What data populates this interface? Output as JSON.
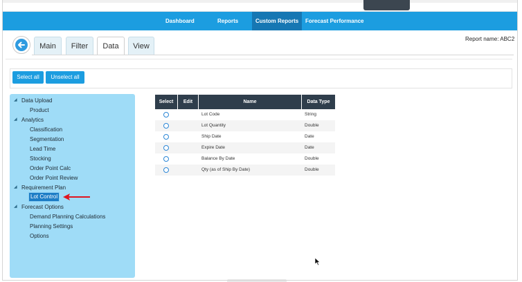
{
  "navbar": {
    "items": [
      "Dashboard",
      "Reports",
      "Custom Reports",
      "Forecast Performance"
    ],
    "active": "Custom Reports"
  },
  "tabs": [
    "Main",
    "Filter",
    "Data",
    "View"
  ],
  "selected_tab": "Data",
  "report_name": "Report name: ABC2",
  "buttons": {
    "select_all": "Select all",
    "unselect_all": "Unselect all"
  },
  "tree": [
    {
      "label": "Data Upload",
      "level": 0,
      "expanded": true
    },
    {
      "label": "Product",
      "level": 1
    },
    {
      "label": "Analytics",
      "level": 0,
      "expanded": true
    },
    {
      "label": "Classification",
      "level": 1
    },
    {
      "label": "Segmentation",
      "level": 1
    },
    {
      "label": "Lead Time",
      "level": 1
    },
    {
      "label": "Stocking",
      "level": 1
    },
    {
      "label": "Order Point Calc",
      "level": 1
    },
    {
      "label": "Order Point Review",
      "level": 1
    },
    {
      "label": "Requirement Plan",
      "level": 0,
      "expanded": true
    },
    {
      "label": "Lot Control",
      "level": 1,
      "selected": true
    },
    {
      "label": "Forecast Options",
      "level": 0,
      "expanded": true
    },
    {
      "label": "Demand Planning Calculations",
      "level": 1
    },
    {
      "label": "Planning Settings",
      "level": 1
    },
    {
      "label": "Options",
      "level": 1
    }
  ],
  "table": {
    "headers": [
      "Select",
      "Edit",
      "Name",
      "Data Type"
    ],
    "rows": [
      {
        "name": "Lot Code",
        "type": "String"
      },
      {
        "name": "Lot Quantity",
        "type": "Double"
      },
      {
        "name": "Ship Date",
        "type": "Date"
      },
      {
        "name": "Expire Date",
        "type": "Date"
      },
      {
        "name": "Balance By Date",
        "type": "Double"
      },
      {
        "name": "Qty (as of Ship By Date)",
        "type": "Double"
      }
    ]
  },
  "colors": {
    "navbar": "#1c9de0",
    "navbar_active": "#1677b3",
    "sidebar": "#9fdcf7",
    "table_header": "#2f3e4c",
    "annotation_arrow": "#e0141e"
  },
  "icons": {
    "back": "arrow-left-icon",
    "tree_expanded": "triangle-down-icon",
    "cursor": "mouse-pointer-icon"
  }
}
